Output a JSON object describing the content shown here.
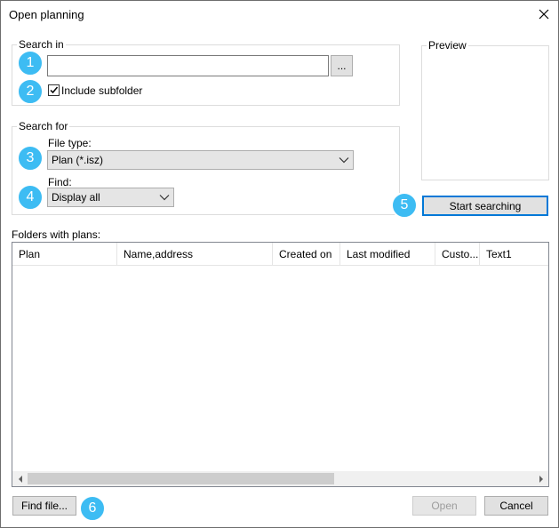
{
  "window": {
    "title": "Open planning"
  },
  "search_in": {
    "group_label": "Search in",
    "path_value": "",
    "browse_label": "...",
    "include_subfolder_label": "Include subfolder",
    "include_subfolder_checked": true
  },
  "search_for": {
    "group_label": "Search for",
    "file_type_label": "File type:",
    "file_type_value": "Plan (*.isz)",
    "find_label": "Find:",
    "find_value": "Display all"
  },
  "preview": {
    "group_label": "Preview"
  },
  "start_searching_label": "Start searching",
  "folders_label": "Folders with plans:",
  "table": {
    "columns": [
      "Plan",
      "Name,address",
      "Created on",
      "Last modified",
      "Custo...",
      "Text1"
    ],
    "rows": []
  },
  "footer": {
    "find_file_label": "Find file...",
    "open_label": "Open",
    "cancel_label": "Cancel"
  },
  "badges": [
    "1",
    "2",
    "3",
    "4",
    "5",
    "6"
  ],
  "colors": {
    "badge": "#3dbcf3",
    "focus": "#0078d7"
  }
}
